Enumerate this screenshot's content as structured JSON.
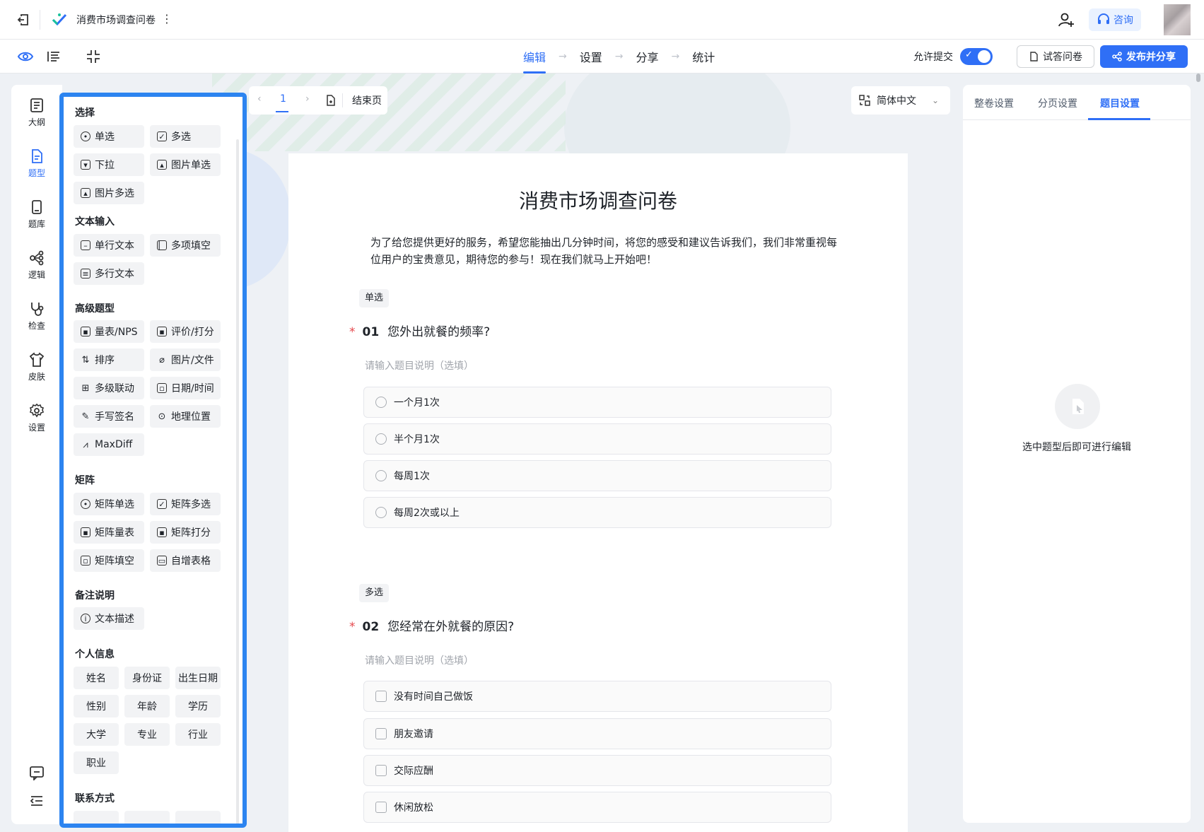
{
  "header": {
    "title": "消费市场调查问卷",
    "more_label": "⋮",
    "consult_label": "咨询"
  },
  "toolbar": {
    "steps": [
      "编辑",
      "设置",
      "分享",
      "统计"
    ],
    "allow_submit_label": "允许提交",
    "allow_submit": true,
    "try_label": "试答问卷",
    "publish_label": "发布并分享"
  },
  "sidebar": {
    "items": [
      {
        "label": "大纲",
        "icon": "outline-icon"
      },
      {
        "label": "题型",
        "icon": "question-type-icon"
      },
      {
        "label": "题库",
        "icon": "question-bank-icon"
      },
      {
        "label": "逻辑",
        "icon": "logic-icon"
      },
      {
        "label": "检查",
        "icon": "check-icon"
      },
      {
        "label": "皮肤",
        "icon": "skin-icon"
      },
      {
        "label": "设置",
        "icon": "settings-icon"
      }
    ],
    "active_index": 1
  },
  "qtypes": {
    "sections": {
      "choice": "选择",
      "text": "文本输入",
      "advanced": "高级题型",
      "matrix": "矩阵",
      "note": "备注说明",
      "personal": "个人信息",
      "contact": "联系方式"
    },
    "choice": [
      "单选",
      "多选",
      "下拉",
      "图片单选",
      "图片多选"
    ],
    "text": [
      "单行文本",
      "多项填空",
      "多行文本"
    ],
    "advanced": [
      "量表/NPS",
      "评价/打分",
      "排序",
      "图片/文件",
      "多级联动",
      "日期/时间",
      "手写签名",
      "地理位置",
      "MaxDiff"
    ],
    "matrix": [
      "矩阵单选",
      "矩阵多选",
      "矩阵量表",
      "矩阵打分",
      "矩阵填空",
      "自增表格"
    ],
    "note": [
      "文本描述"
    ],
    "personal": [
      "姓名",
      "身份证",
      "出生日期",
      "性别",
      "年龄",
      "学历",
      "大学",
      "专业",
      "行业",
      "职业"
    ]
  },
  "pager": {
    "current_page": "1",
    "end_page_label": "结束页"
  },
  "language": {
    "selected": "简体中文"
  },
  "survey": {
    "title": "消费市场调查问卷",
    "intro": "为了给您提供更好的服务，希望您能抽出几分钟时间，将您的感受和建议告诉我们，我们非常重视每位用户的宝贵意见，期待您的参与！现在我们就马上开始吧！",
    "questions": [
      {
        "tag": "单选",
        "required": "*",
        "number": "01",
        "title": "您外出就餐的频率?",
        "desc_placeholder": "请输入题目说明（选填）",
        "options": [
          "一个月1次",
          "半个月1次",
          "每周1次",
          "每周2次或以上"
        ]
      },
      {
        "tag": "多选",
        "required": "*",
        "number": "02",
        "title": "您经常在外就餐的原因?",
        "desc_placeholder": "请输入题目说明（选填）",
        "options": [
          "没有时间自己做饭",
          "朋友邀请",
          "交际应酬",
          "休闲放松"
        ]
      }
    ]
  },
  "right_panel": {
    "tabs": [
      "整卷设置",
      "分页设置",
      "题目设置"
    ],
    "active_tab": 2,
    "empty_text": "选中题型后即可进行编辑"
  },
  "colors": {
    "accent": "#2f6ff6",
    "highlight_border": "#2c84f0",
    "required": "#e5484d"
  }
}
